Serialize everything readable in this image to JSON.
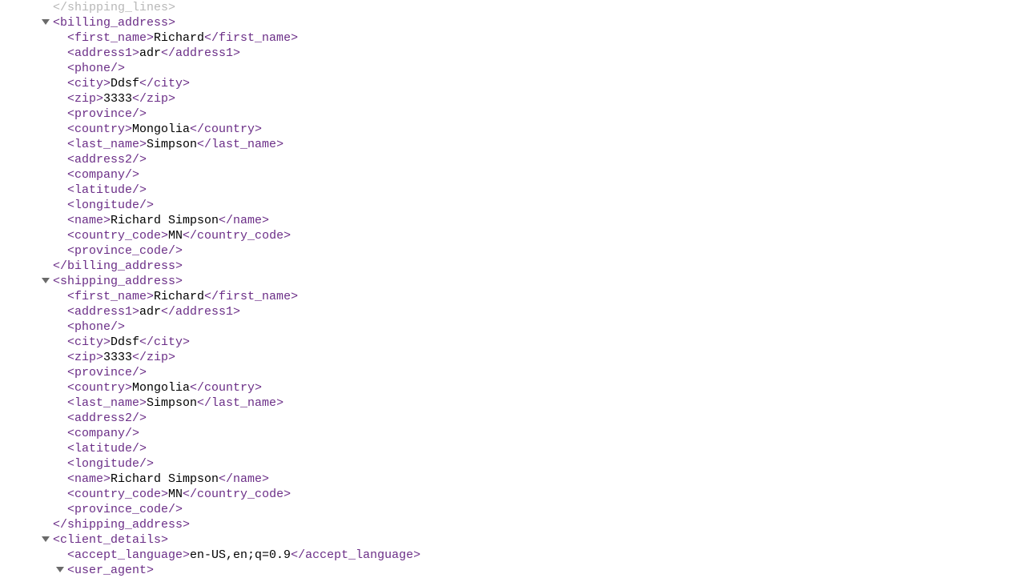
{
  "top_cut": "</shipping_lines>",
  "billing": {
    "open": "billing_address",
    "fields": [
      {
        "tag": "first_name",
        "val": "Richard",
        "self": false
      },
      {
        "tag": "address1",
        "val": "adr",
        "self": false
      },
      {
        "tag": "phone",
        "val": "",
        "self": true
      },
      {
        "tag": "city",
        "val": "Ddsf",
        "self": false
      },
      {
        "tag": "zip",
        "val": "3333",
        "self": false
      },
      {
        "tag": "province",
        "val": "",
        "self": true
      },
      {
        "tag": "country",
        "val": "Mongolia",
        "self": false
      },
      {
        "tag": "last_name",
        "val": "Simpson",
        "self": false
      },
      {
        "tag": "address2",
        "val": "",
        "self": true
      },
      {
        "tag": "company",
        "val": "",
        "self": true
      },
      {
        "tag": "latitude",
        "val": "",
        "self": true
      },
      {
        "tag": "longitude",
        "val": "",
        "self": true
      },
      {
        "tag": "name",
        "val": "Richard Simpson",
        "self": false
      },
      {
        "tag": "country_code",
        "val": "MN",
        "self": false
      },
      {
        "tag": "province_code",
        "val": "",
        "self": true
      }
    ],
    "close": "billing_address"
  },
  "shipping": {
    "open": "shipping_address",
    "fields": [
      {
        "tag": "first_name",
        "val": "Richard",
        "self": false
      },
      {
        "tag": "address1",
        "val": "adr",
        "self": false
      },
      {
        "tag": "phone",
        "val": "",
        "self": true
      },
      {
        "tag": "city",
        "val": "Ddsf",
        "self": false
      },
      {
        "tag": "zip",
        "val": "3333",
        "self": false
      },
      {
        "tag": "province",
        "val": "",
        "self": true
      },
      {
        "tag": "country",
        "val": "Mongolia",
        "self": false
      },
      {
        "tag": "last_name",
        "val": "Simpson",
        "self": false
      },
      {
        "tag": "address2",
        "val": "",
        "self": true
      },
      {
        "tag": "company",
        "val": "",
        "self": true
      },
      {
        "tag": "latitude",
        "val": "",
        "self": true
      },
      {
        "tag": "longitude",
        "val": "",
        "self": true
      },
      {
        "tag": "name",
        "val": "Richard Simpson",
        "self": false
      },
      {
        "tag": "country_code",
        "val": "MN",
        "self": false
      },
      {
        "tag": "province_code",
        "val": "",
        "self": true
      }
    ],
    "close": "shipping_address"
  },
  "client": {
    "open": "client_details",
    "accept_language": {
      "tag": "accept_language",
      "val": "en-US,en;q=0.9"
    },
    "user_agent_open": "user_agent"
  }
}
